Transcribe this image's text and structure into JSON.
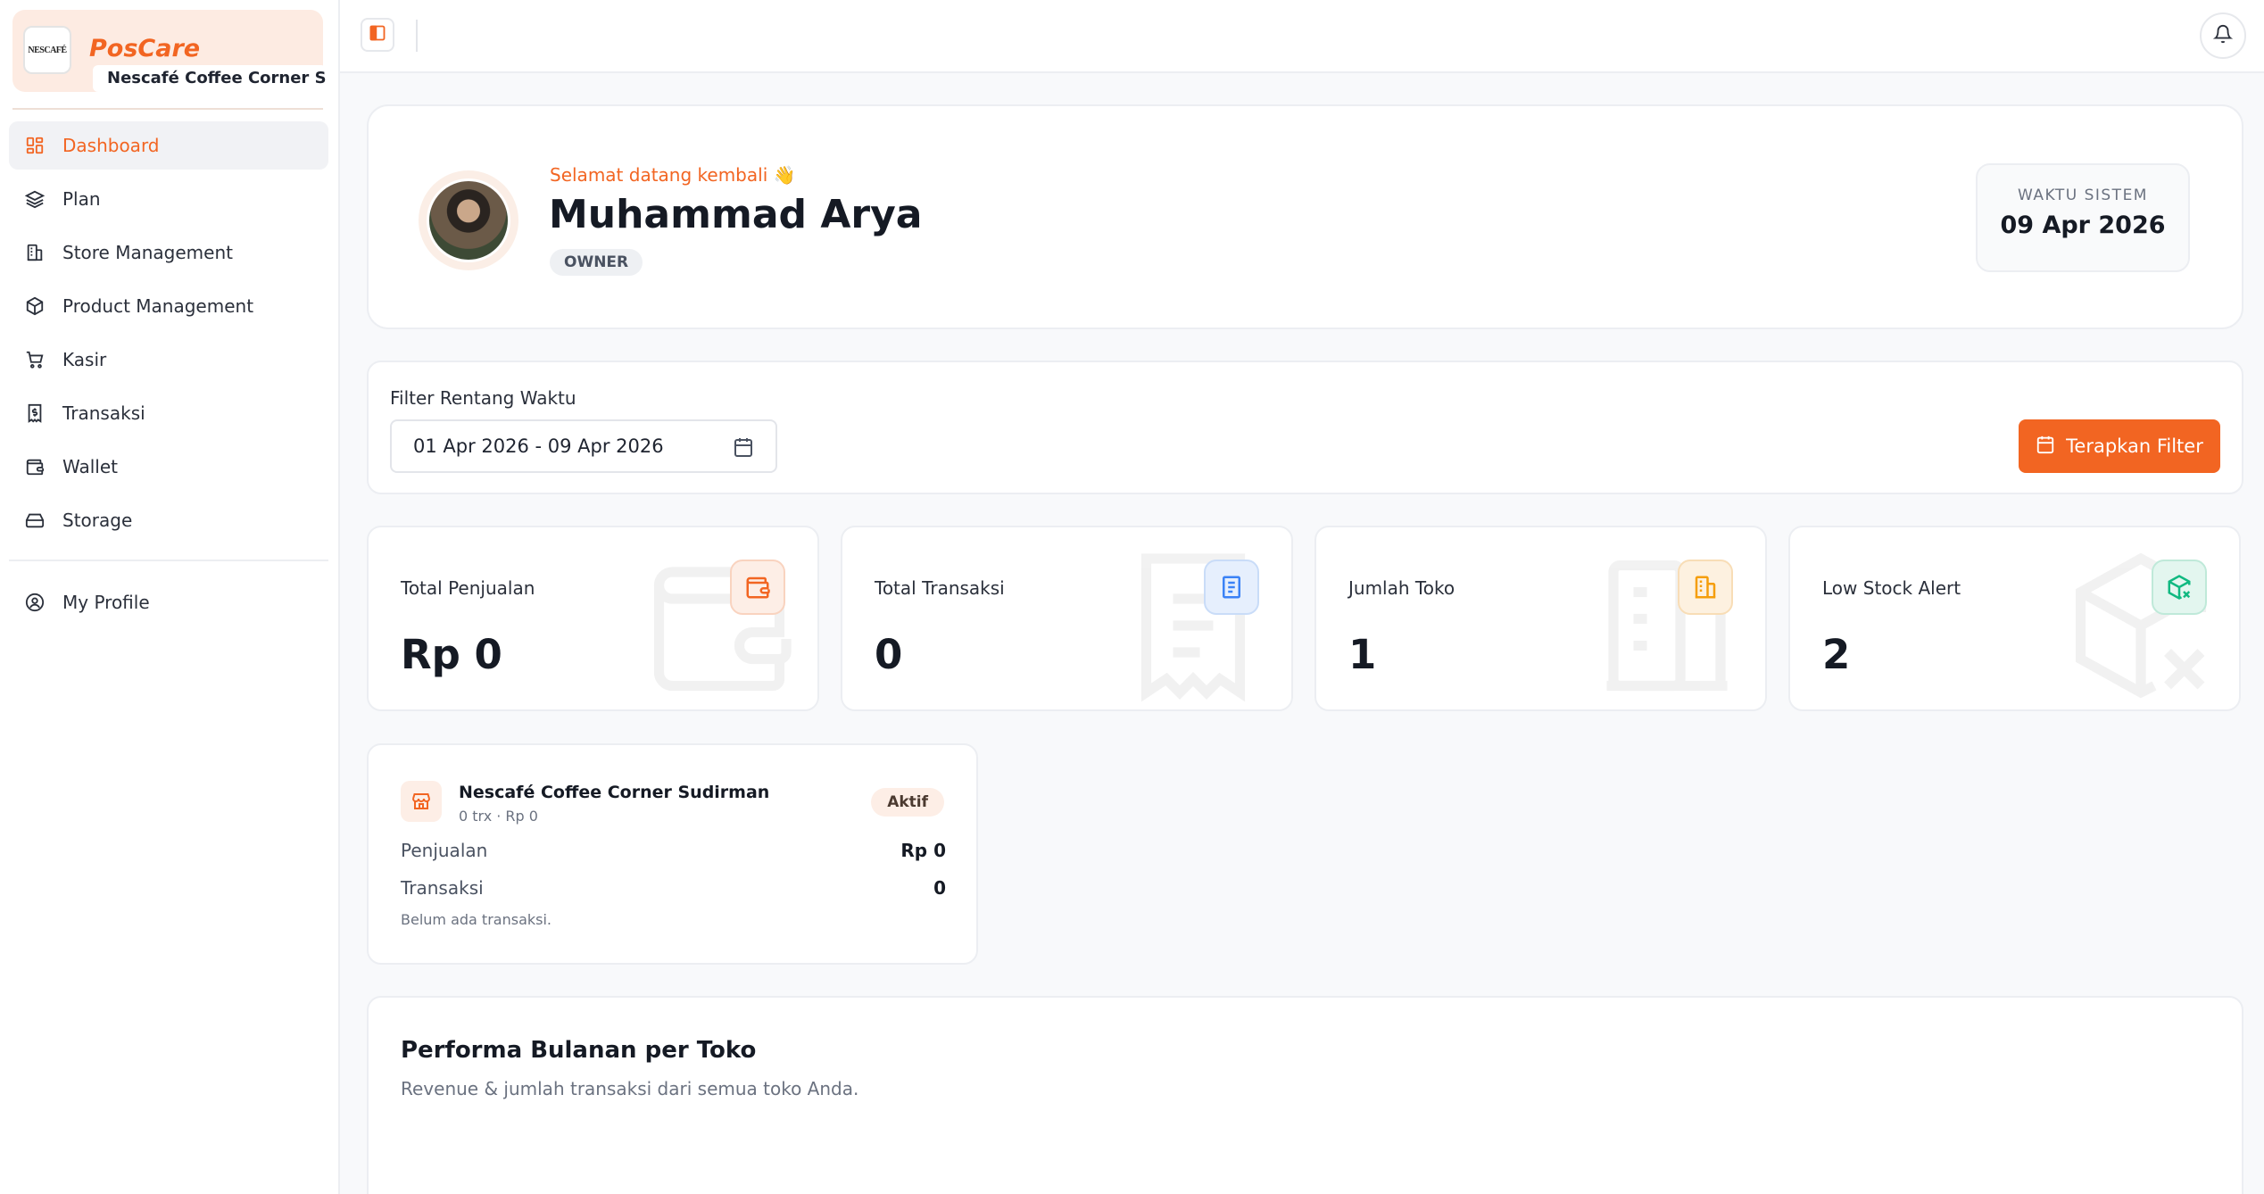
{
  "brand": {
    "logo_text": "NESCAFÉ",
    "app_name": "PosCare",
    "store_name": "Nescafé Coffee Corner Sud..."
  },
  "sidebar": {
    "items": [
      {
        "label": "Dashboard",
        "icon": "dashboard-icon",
        "active": true
      },
      {
        "label": "Plan",
        "icon": "layers-icon"
      },
      {
        "label": "Store Management",
        "icon": "building-icon"
      },
      {
        "label": "Product Management",
        "icon": "package-icon"
      },
      {
        "label": "Kasir",
        "icon": "cart-icon"
      },
      {
        "label": "Transaksi",
        "icon": "receipt-icon"
      },
      {
        "label": "Wallet",
        "icon": "wallet-icon"
      },
      {
        "label": "Storage",
        "icon": "storage-icon"
      }
    ],
    "profile": {
      "label": "My Profile",
      "icon": "user-circle-icon"
    }
  },
  "welcome": {
    "greeting": "Selamat datang kembali 👋",
    "name": "Muhammad Arya",
    "role": "OWNER",
    "time_label": "WAKTU SISTEM",
    "time_value": "09 Apr 2026"
  },
  "filter": {
    "label": "Filter Rentang Waktu",
    "range": "01 Apr 2026 - 09 Apr 2026",
    "apply_label": "Terapkan Filter"
  },
  "stats": [
    {
      "title": "Total Penjualan",
      "value": "Rp 0",
      "icon": "wallet-icon",
      "color": "#f26522",
      "bg": "#fdeee6"
    },
    {
      "title": "Total Transaksi",
      "value": "0",
      "icon": "receipt-icon",
      "color": "#3b82f6",
      "bg": "#e6effd"
    },
    {
      "title": "Jumlah Toko",
      "value": "1",
      "icon": "building-icon",
      "color": "#f59e0b",
      "bg": "#fdf1e0"
    },
    {
      "title": "Low Stock Alert",
      "value": "2",
      "icon": "package-x-icon",
      "color": "#10b981",
      "bg": "#e3f6ef"
    }
  ],
  "store": {
    "name": "Nescafé Coffee Corner Sudirman",
    "sub": "0 trx · Rp 0",
    "status": "Aktif",
    "sales_label": "Penjualan",
    "sales_value": "Rp 0",
    "trx_label": "Transaksi",
    "trx_value": "0",
    "note": "Belum ada transaksi."
  },
  "performance": {
    "title": "Performa Bulanan per Toko",
    "subtitle": "Revenue & jumlah transaksi dari semua toko Anda."
  },
  "colors": {
    "accent": "#f26522"
  }
}
